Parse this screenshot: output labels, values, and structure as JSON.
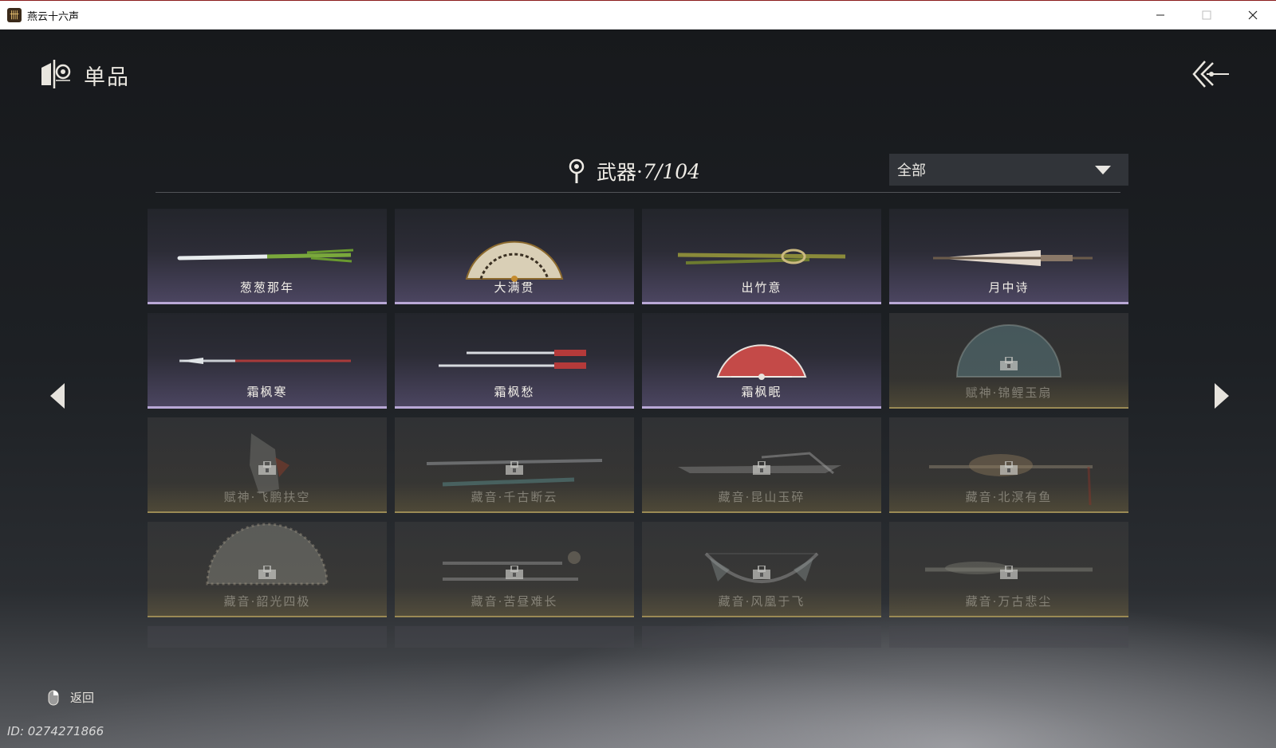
{
  "window": {
    "title": "燕云十六声",
    "icon": "game-app-icon",
    "controls": [
      "minimize-icon",
      "maximize-icon",
      "close-icon"
    ]
  },
  "header": {
    "icon": "collection-emblem-icon",
    "title": "单品",
    "back_icon": "back-arrows-icon"
  },
  "category": {
    "icon": "location-pin-icon",
    "name": "武器",
    "separator": "·",
    "count": "7/",
    "total": "104"
  },
  "filter": {
    "selected": "全部",
    "caret_icon": "chevron-down-icon"
  },
  "items": [
    {
      "name": "葱葱那年",
      "locked": false,
      "art": "scallion"
    },
    {
      "name": "大满贯",
      "locked": false,
      "art": "fan-gold"
    },
    {
      "name": "出竹意",
      "locked": false,
      "art": "bamboo"
    },
    {
      "name": "月中诗",
      "locked": false,
      "art": "umbrella"
    },
    {
      "name": "霜枫寒",
      "locked": false,
      "art": "spear"
    },
    {
      "name": "霜枫愁",
      "locked": false,
      "art": "twin-blades"
    },
    {
      "name": "霜枫眠",
      "locked": false,
      "art": "fan-red"
    },
    {
      "name": "赋神·锦鲤玉扇",
      "locked": true,
      "art": "fan-koi"
    },
    {
      "name": "赋神·飞鹏扶空",
      "locked": true,
      "art": "wing"
    },
    {
      "name": "藏音·千古断云",
      "locked": true,
      "art": "long-sword"
    },
    {
      "name": "藏音·昆山玉碎",
      "locked": true,
      "art": "dragon-blade"
    },
    {
      "name": "藏音·北溟有鱼",
      "locked": true,
      "art": "fish-spear"
    },
    {
      "name": "藏音·韶光四极",
      "locked": true,
      "art": "fan-spiked"
    },
    {
      "name": "藏音·苦昼难长",
      "locked": true,
      "art": "twin-daggers"
    },
    {
      "name": "藏音·风凰于飞",
      "locked": true,
      "art": "phoenix-bow"
    },
    {
      "name": "藏音·万古悲尘",
      "locked": true,
      "art": "staff"
    }
  ],
  "navigation": {
    "prev_icon": "arrow-left-icon",
    "next_icon": "arrow-right-icon"
  },
  "footer": {
    "return_icon": "mouse-right-click-icon",
    "return_label": "返回",
    "player_id": "ID: 0274271866"
  },
  "colors": {
    "unlocked_border": "#b9a8d6",
    "locked_border": "#9a8a55"
  }
}
